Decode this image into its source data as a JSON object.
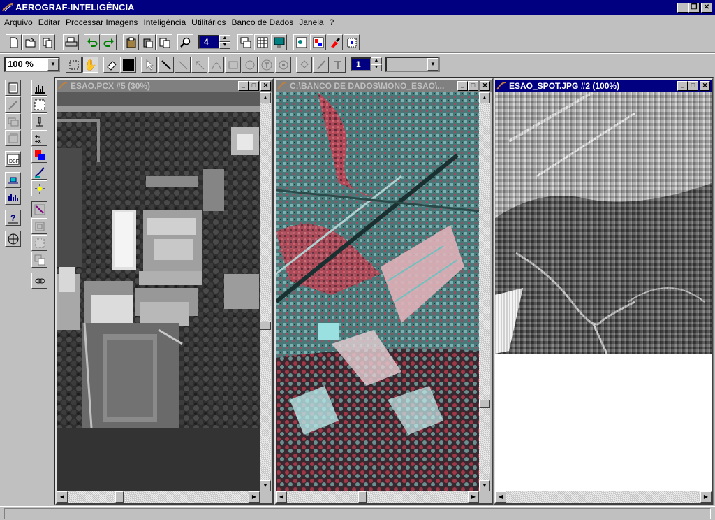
{
  "app": {
    "title": "AEROGRAF-INTELIGÊNCIA"
  },
  "menu": [
    "Arquivo",
    "Editar",
    "Processar Imagens",
    "Inteligência",
    "Utilitários",
    "Banco de Dados",
    "Janela",
    "?"
  ],
  "toolbar": {
    "top_spin_value": "4",
    "zoom_value": "100 %",
    "line_width_value": "1"
  },
  "windows": [
    {
      "title": "ESAO.PCX #5 (30%)",
      "active": false
    },
    {
      "title": "C:\\BANCO DE DADOS\\MONO_ESAO\\...",
      "active": false
    },
    {
      "title": "ESAO_SPOT.JPG #2 (100%)",
      "active": true
    }
  ],
  "colors": {
    "titlebar": "#000080",
    "face": "#c0c0c0",
    "inactive_title": "#808080"
  }
}
